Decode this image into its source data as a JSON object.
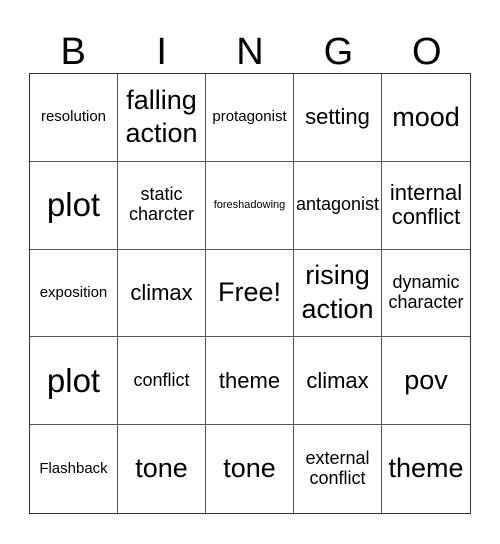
{
  "header": {
    "letters": [
      "B",
      "I",
      "N",
      "G",
      "O"
    ]
  },
  "board": {
    "rows": [
      [
        "resolution",
        "falling action",
        "protagonist",
        "setting",
        "mood"
      ],
      [
        "plot",
        "static charcter",
        "foreshadowing",
        "antagonist",
        "internal conflict"
      ],
      [
        "exposition",
        "climax",
        "Free!",
        "rising action",
        "dynamic character"
      ],
      [
        "plot",
        "conflict",
        "theme",
        "climax",
        "pov"
      ],
      [
        "Flashback",
        "tone",
        "tone",
        "external conflict",
        "theme"
      ]
    ],
    "free_space": "Free!"
  }
}
